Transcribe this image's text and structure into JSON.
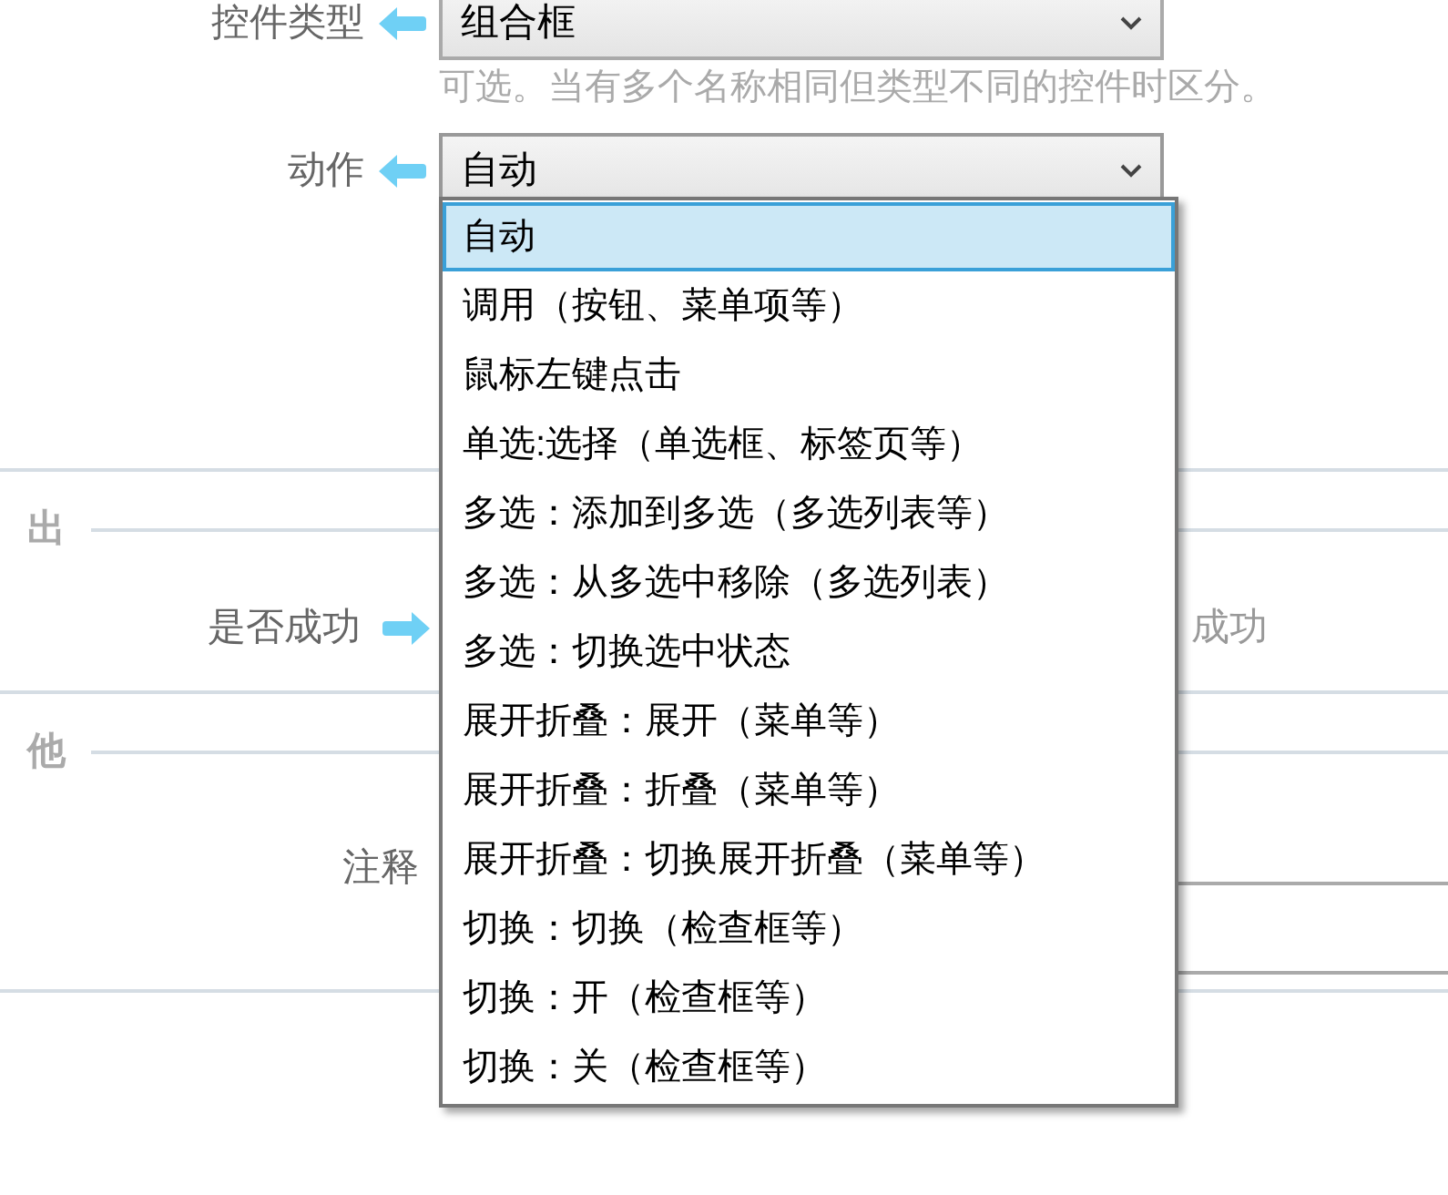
{
  "control_type": {
    "label": "控件类型",
    "value": "组合框",
    "hint": "可选。当有多个名称相同但类型不同的控件时区分。"
  },
  "action": {
    "label": "动作",
    "value": "自动",
    "expanded": true,
    "options": [
      {
        "label": "自动",
        "selected": true
      },
      {
        "label": "调用（按钮、菜单项等）",
        "selected": false
      },
      {
        "label": "鼠标左键点击",
        "selected": false
      },
      {
        "label": "单选:选择（单选框、标签页等）",
        "selected": false
      },
      {
        "label": "多选：添加到多选（多选列表等）",
        "selected": false
      },
      {
        "label": "多选：从多选中移除（多选列表）",
        "selected": false
      },
      {
        "label": "多选：切换选中状态",
        "selected": false
      },
      {
        "label": "展开折叠：展开（菜单等）",
        "selected": false
      },
      {
        "label": "展开折叠：折叠（菜单等）",
        "selected": false
      },
      {
        "label": "展开折叠：切换展开折叠（菜单等）",
        "selected": false
      },
      {
        "label": "切换：切换（检查框等）",
        "selected": false
      },
      {
        "label": "切换：开（检查框等）",
        "selected": false
      },
      {
        "label": "切换：关（检查框等）",
        "selected": false
      }
    ]
  },
  "output_section": {
    "title": "出",
    "success": {
      "label": "是否成功",
      "placeholder": "成功"
    }
  },
  "other_section": {
    "title": "他",
    "comment": {
      "label": "注释"
    }
  }
}
